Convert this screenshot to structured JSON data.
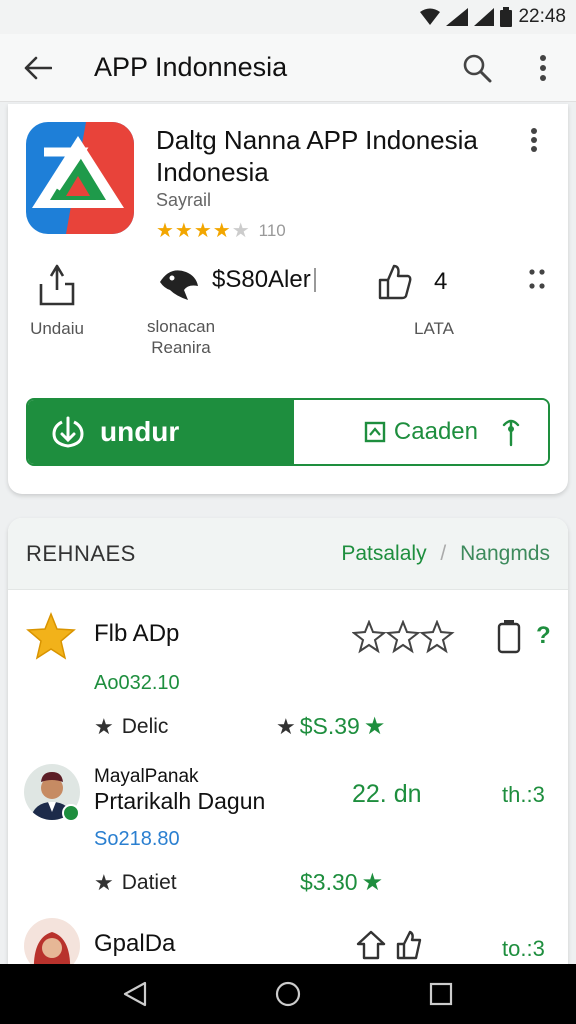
{
  "status": {
    "time": "22:48"
  },
  "appbar": {
    "title": "APP Indonnesia"
  },
  "app": {
    "name": "Daltg Nanna APP Indonesia Indonesia",
    "developer": "Sayrail",
    "rating_count": "110",
    "rating_stars": 4
  },
  "stats": {
    "unduh_label": "Undaiu",
    "ulasan_label_1": "slonacan",
    "ulasan_label_2": "Reanira",
    "price_value": "$S80Aler",
    "likes_value": "4",
    "likes_label": "LATA"
  },
  "buttons": {
    "install_label": "undur",
    "wishlist_label": "Caaden"
  },
  "section": {
    "title": "REHNAES",
    "link_primary": "Patsalaly",
    "link_secondary": "Nangmds"
  },
  "items": [
    {
      "title": "Flb ADp",
      "subtitle": "Ao032.10",
      "meta_label": "Delic",
      "price": "$S.39",
      "side_value": "?"
    },
    {
      "title_small": "MayalPanak",
      "title": "Prtarikalh Dagun",
      "subtitle": "So218.80",
      "meta_label": "Datiet",
      "price": "$3.30",
      "mid_value": "22. dn",
      "side_value": "th.:3"
    },
    {
      "title": "GpalDa",
      "side_value": "to.:3"
    }
  ],
  "colors": {
    "accent": "#1e8e3e",
    "star": "#f2a600"
  }
}
